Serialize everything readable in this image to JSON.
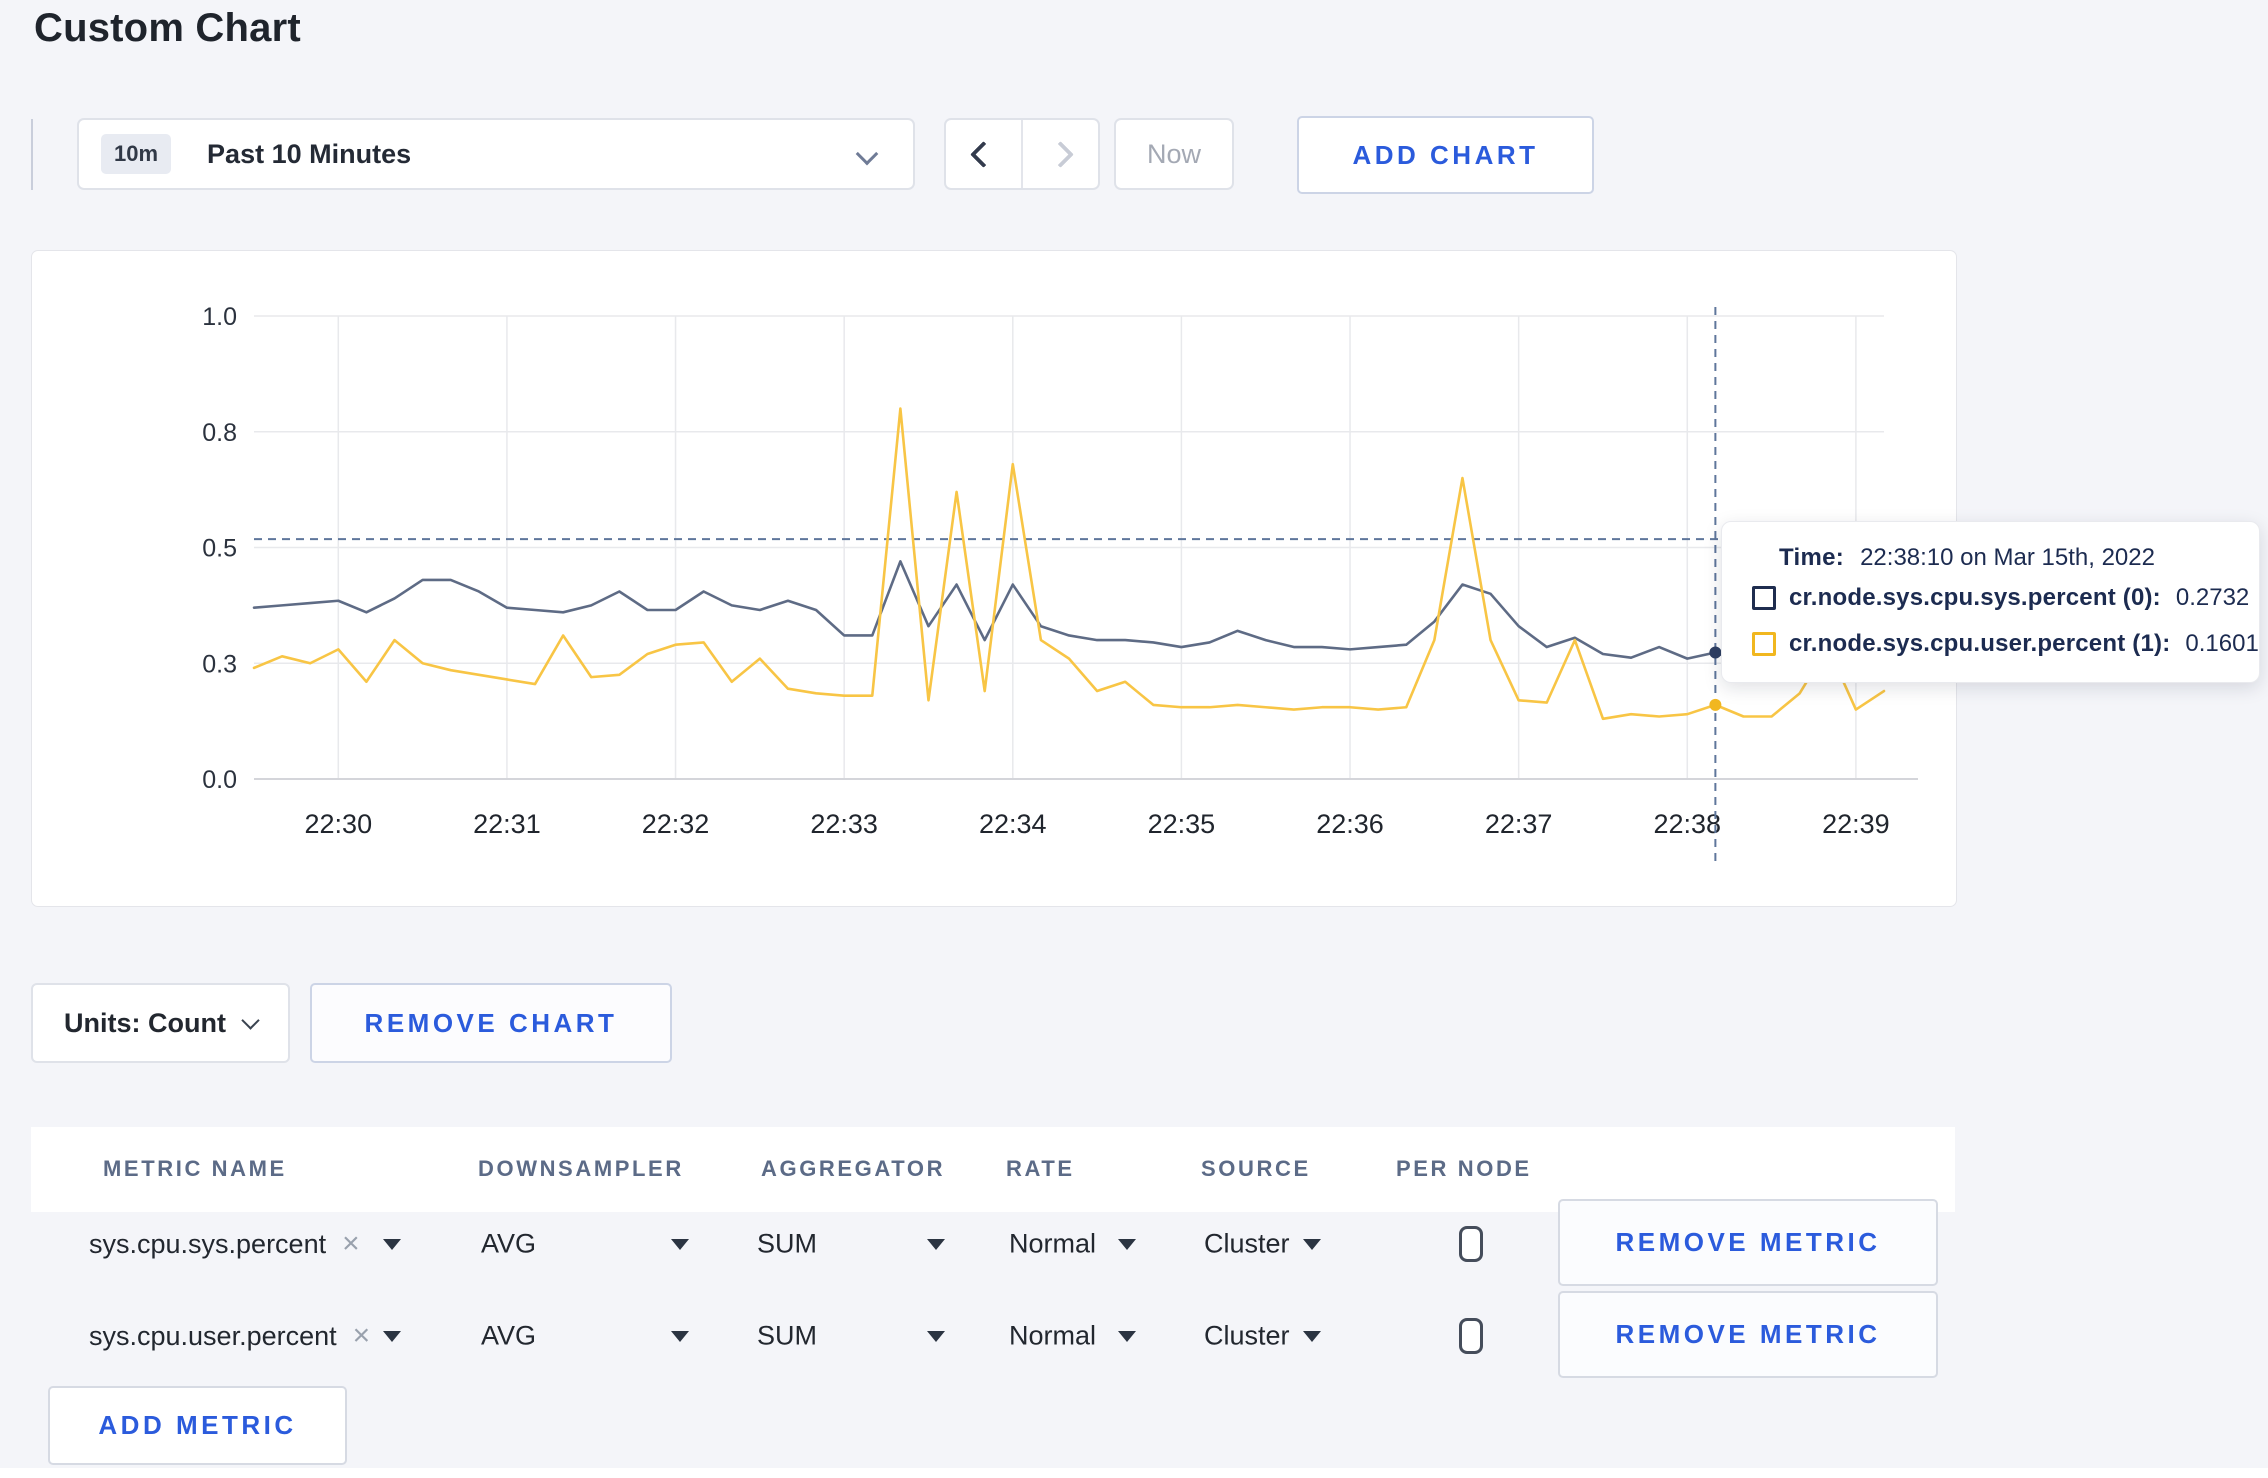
{
  "page": {
    "title": "Custom Chart",
    "background": "#f4f5f9",
    "accent_blue": "#2b5bdc"
  },
  "toolbar": {
    "time_range": {
      "badge": "10m",
      "label": "Past 10 Minutes"
    },
    "now_label": "Now",
    "add_chart_label": "ADD CHART"
  },
  "icons": {
    "close": "×"
  },
  "chart_data": {
    "type": "line",
    "title": "",
    "x_start": "22:29:30",
    "x_end": "22:39:10",
    "x_step_seconds": 10,
    "ylim": [
      0,
      1
    ],
    "grid": true,
    "y_ticks": [
      {
        "v": 1.0,
        "label": "1.0"
      },
      {
        "v": 0.75,
        "label": "0.8"
      },
      {
        "v": 0.5,
        "label": "0.5"
      },
      {
        "v": 0.25,
        "label": "0.3"
      },
      {
        "v": 0.0,
        "label": "0.0"
      }
    ],
    "x_ticks": [
      {
        "t": 30,
        "label": "22:30"
      },
      {
        "t": 90,
        "label": "22:31"
      },
      {
        "t": 150,
        "label": "22:32"
      },
      {
        "t": 210,
        "label": "22:33"
      },
      {
        "t": 270,
        "label": "22:34"
      },
      {
        "t": 330,
        "label": "22:35"
      },
      {
        "t": 390,
        "label": "22:36"
      },
      {
        "t": 450,
        "label": "22:37"
      },
      {
        "t": 510,
        "label": "22:38"
      },
      {
        "t": 570,
        "label": "22:39"
      }
    ],
    "series": [
      {
        "name": "cr.node.sys.cpu.sys.percent",
        "color": "#5e6b85",
        "legend_color": "#1f2d4f",
        "dot_color": "#2e3f63",
        "values": [
          0.37,
          0.375,
          0.38,
          0.385,
          0.36,
          0.39,
          0.43,
          0.43,
          0.405,
          0.37,
          0.365,
          0.36,
          0.375,
          0.405,
          0.365,
          0.365,
          0.405,
          0.375,
          0.365,
          0.385,
          0.365,
          0.31,
          0.31,
          0.47,
          0.33,
          0.42,
          0.3,
          0.42,
          0.33,
          0.31,
          0.3,
          0.3,
          0.295,
          0.285,
          0.295,
          0.32,
          0.3,
          0.285,
          0.285,
          0.28,
          0.285,
          0.29,
          0.34,
          0.42,
          0.4,
          0.33,
          0.285,
          0.305,
          0.27,
          0.262,
          0.285,
          0.26,
          0.2732,
          0.25,
          0.27,
          0.28,
          0.285,
          0.285,
          0.29
        ]
      },
      {
        "name": "cr.node.sys.cpu.user.percent",
        "color": "#f8c545",
        "legend_color": "#f1b71f",
        "dot_color": "#f1b71f",
        "values": [
          0.24,
          0.265,
          0.25,
          0.28,
          0.21,
          0.3,
          0.25,
          0.235,
          0.225,
          0.215,
          0.205,
          0.31,
          0.22,
          0.225,
          0.27,
          0.29,
          0.295,
          0.21,
          0.26,
          0.195,
          0.185,
          0.18,
          0.18,
          0.8,
          0.17,
          0.62,
          0.19,
          0.68,
          0.3,
          0.26,
          0.19,
          0.21,
          0.16,
          0.155,
          0.155,
          0.16,
          0.155,
          0.15,
          0.155,
          0.155,
          0.15,
          0.155,
          0.3,
          0.65,
          0.3,
          0.17,
          0.165,
          0.3,
          0.13,
          0.14,
          0.135,
          0.14,
          0.1601,
          0.135,
          0.135,
          0.185,
          0.285,
          0.15,
          0.19
        ]
      }
    ],
    "hover": {
      "t": 520,
      "time": "22:38:10",
      "values": [
        0.2732,
        0.1601
      ],
      "value_guide": 0.518
    }
  },
  "tooltip": {
    "time_label": "Time:",
    "time_value": "22:38:10 on Mar 15th, 2022",
    "rows": [
      {
        "label": "cr.node.sys.cpu.sys.percent (0):",
        "value": "0.2732"
      },
      {
        "label": "cr.node.sys.cpu.user.percent (1):",
        "value": "0.1601"
      }
    ]
  },
  "chart_footer": {
    "units_label": "Units: Count",
    "remove_chart_label": "REMOVE CHART"
  },
  "metrics_table": {
    "headers": [
      "METRIC NAME",
      "DOWNSAMPLER",
      "AGGREGATOR",
      "RATE",
      "SOURCE",
      "PER NODE"
    ],
    "rows": [
      {
        "metric": "sys.cpu.sys.percent",
        "downsampler": "AVG",
        "aggregator": "SUM",
        "rate": "Normal",
        "source": "Cluster",
        "per_node": false
      },
      {
        "metric": "sys.cpu.user.percent",
        "downsampler": "AVG",
        "aggregator": "SUM",
        "rate": "Normal",
        "source": "Cluster",
        "per_node": false
      }
    ],
    "remove_metric_label": "REMOVE METRIC",
    "add_metric_label": "ADD METRIC"
  }
}
